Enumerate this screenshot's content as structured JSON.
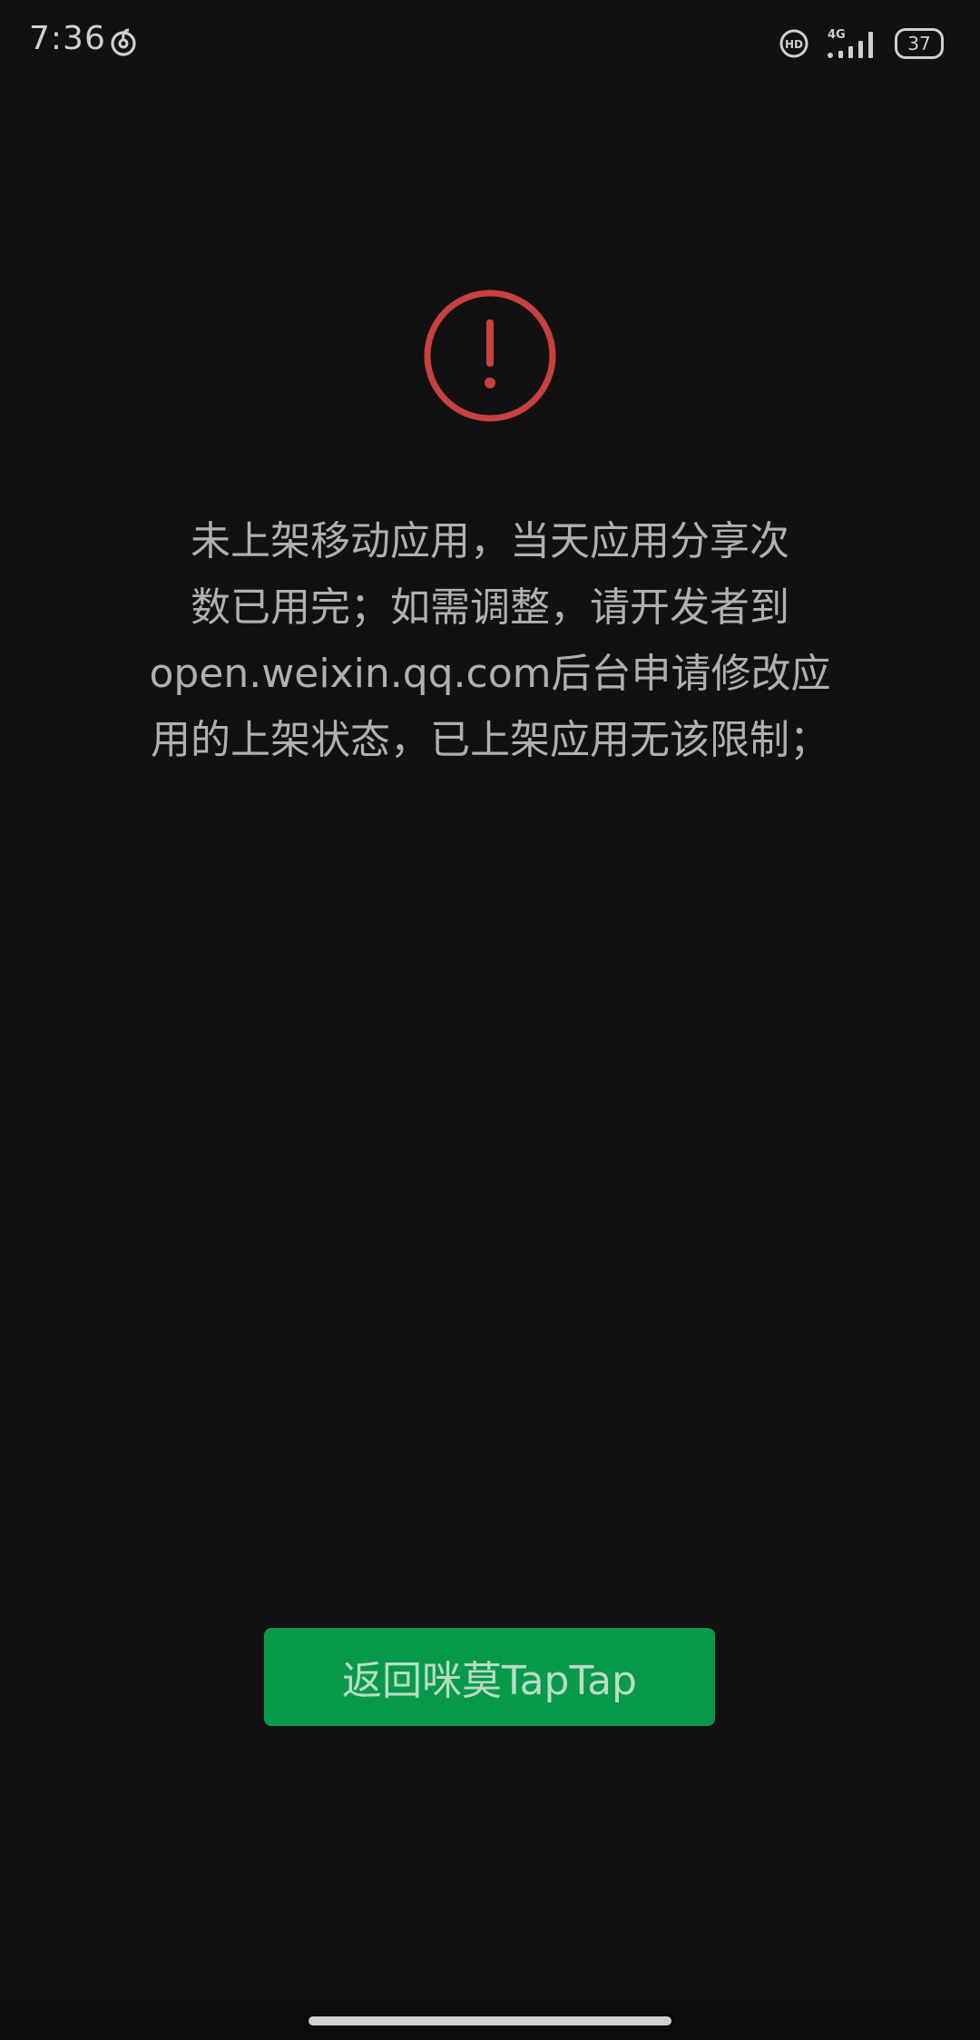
{
  "status_bar": {
    "time": "7:36",
    "app_icon": "netease-music-icon",
    "hd_icon": "hd-icon",
    "network_label": "4G",
    "signal_icon": "signal-icon",
    "battery_level": "37"
  },
  "error": {
    "icon": "warning-exclamation-icon",
    "icon_color": "#c94040",
    "message_lines": [
      "未上架移动应用，当天应用分享次",
      "数已用完；如需调整，请开发者到",
      "open.weixin.qq.com后台申请修改应",
      "用的上架状态，已上架应用无该限制；"
    ]
  },
  "action": {
    "return_label": "返回咪莫TapTap",
    "button_color": "#07994a"
  }
}
